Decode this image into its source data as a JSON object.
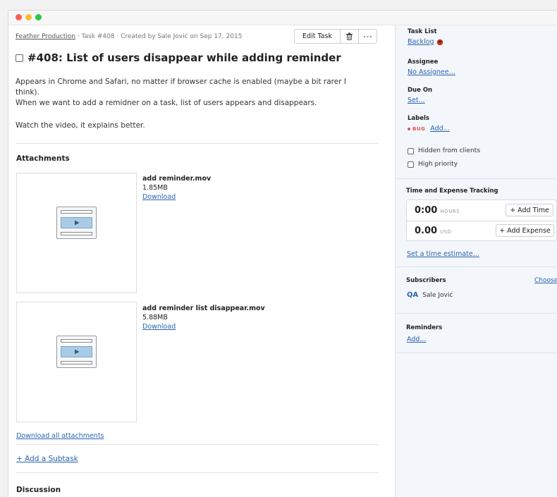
{
  "breadcrumb": {
    "project": "Feather Production",
    "task_info": " · Task #408 · Created by Sale Jović on Sep 17, 2015"
  },
  "toolbar": {
    "edit_label": "Edit Task",
    "trash_icon": "trash-icon",
    "more_icon": "more-icon"
  },
  "task": {
    "title": "#408: List of users disappear while adding reminder",
    "description": [
      "Appears in Chrome and Safari, no matter if browser cache is enabled (maybe a bit rarer I",
      "think).",
      "When we want to add a remidner on a task, list of users appears and disappears.",
      "Watch the video, it explains better."
    ]
  },
  "attachments": {
    "heading": "Attachments",
    "items": [
      {
        "name": "add reminder.mov",
        "size": "1.85MB",
        "download": "Download"
      },
      {
        "name": "add reminder list disappear.mov",
        "size": "5.88MB",
        "download": "Download"
      }
    ],
    "download_all": "Download all attachments"
  },
  "subtask": {
    "add_label": "+ Add a Subtask"
  },
  "discussion": {
    "heading": "Discussion"
  },
  "sidebar": {
    "task_list": {
      "label": "Task List",
      "value": "Backlog"
    },
    "assignee": {
      "label": "Assignee",
      "value": "No Assignee..."
    },
    "due_on": {
      "label": "Due On",
      "value": "Set..."
    },
    "labels": {
      "label": "Labels",
      "bug": "BUG",
      "add": "Add..."
    },
    "options": {
      "hidden": "Hidden from clients",
      "priority": "High priority"
    },
    "tracking": {
      "heading": "Time and Expense Tracking",
      "hours_value": "0:00",
      "hours_unit": "HOURS",
      "add_time": "+ Add Time",
      "expense_value": "0.00",
      "expense_unit": "USD",
      "add_expense": "+ Add Expense",
      "estimate": "Set a time estimate..."
    },
    "subscribers": {
      "heading": "Subscribers",
      "choose": "Choose",
      "user_initials": "QA",
      "user": "Sale Jović"
    },
    "reminders": {
      "heading": "Reminders",
      "add": "Add..."
    }
  },
  "colors": {
    "link": "#2a63b0",
    "bug": "#d9534f",
    "sidebar_bg": "#f3f6fa"
  }
}
